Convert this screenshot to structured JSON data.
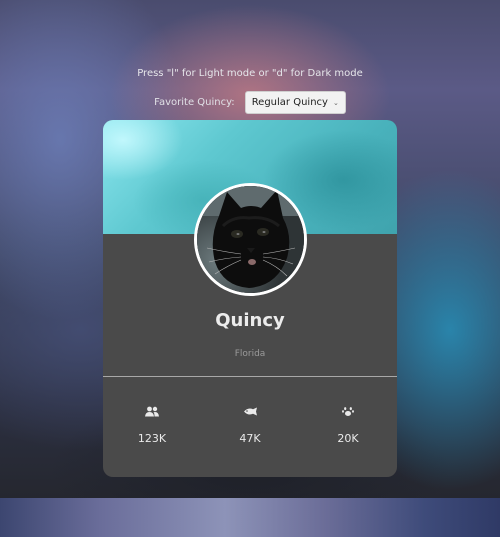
{
  "hint": "Press \"l\" for Light mode or \"d\" for Dark mode",
  "favorite": {
    "label": "Favorite Quincy:",
    "selected": "Regular Quincy"
  },
  "profile": {
    "name": "Quincy",
    "location": "Florida"
  },
  "stats": [
    {
      "icon": "users-icon",
      "value": "123K"
    },
    {
      "icon": "fish-icon",
      "value": "47K"
    },
    {
      "icon": "paw-icon",
      "value": "20K"
    }
  ],
  "colors": {
    "card": "#4a4a4a",
    "banner": "#5ec8d0",
    "text": "#eaeaea",
    "muted": "#9a9a9a"
  }
}
